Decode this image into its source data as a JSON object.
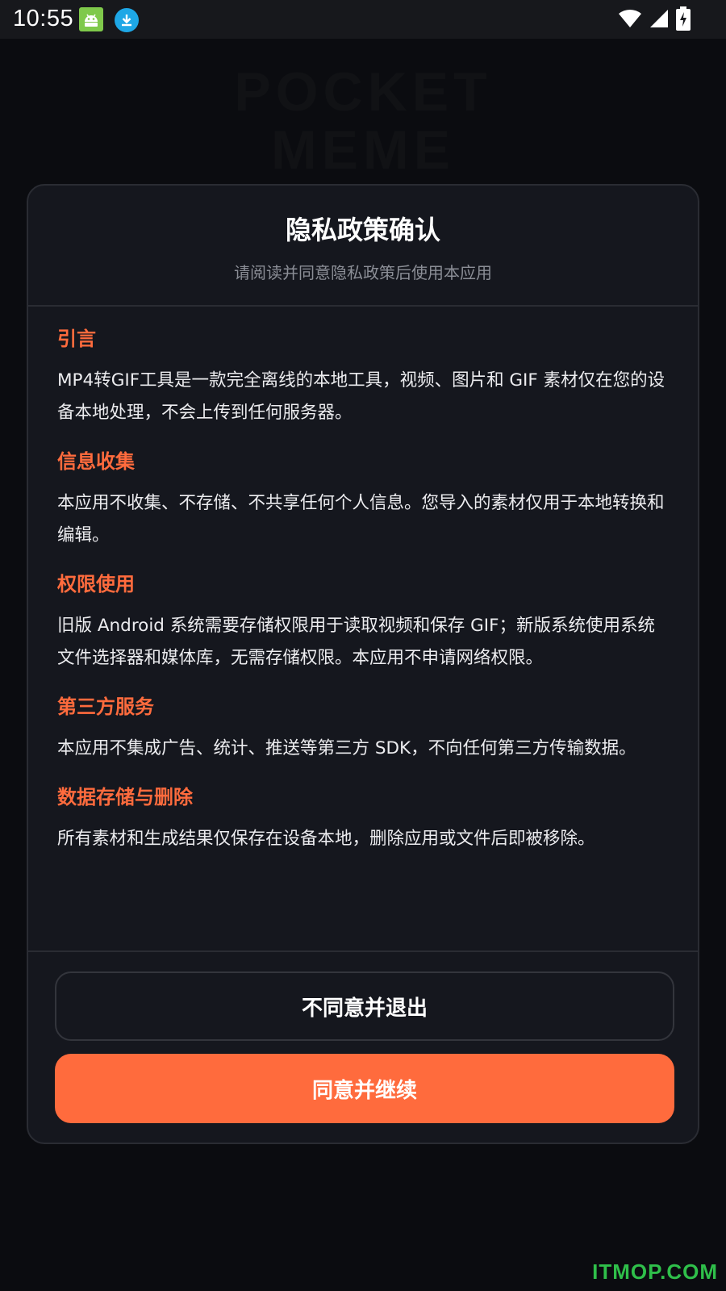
{
  "status_bar": {
    "time": "10:55",
    "icons": [
      "android-notification-icon",
      "download-icon",
      "wifi-icon",
      "cell-signal-icon",
      "battery-charging-icon"
    ]
  },
  "background": {
    "brand_line1": "POCKET",
    "brand_line2": "MEME"
  },
  "dialog": {
    "title": "隐私政策确认",
    "subtitle": "请阅读并同意隐私政策后使用本应用",
    "sections": [
      {
        "heading": "引言",
        "text": "MP4转GIF工具是一款完全离线的本地工具，视频、图片和 GIF 素材仅在您的设备本地处理，不会上传到任何服务器。"
      },
      {
        "heading": "信息收集",
        "text": "本应用不收集、不存储、不共享任何个人信息。您导入的素材仅用于本地转换和编辑。"
      },
      {
        "heading": "权限使用",
        "text": "旧版 Android 系统需要存储权限用于读取视频和保存 GIF；新版系统使用系统文件选择器和媒体库，无需存储权限。本应用不申请网络权限。"
      },
      {
        "heading": "第三方服务",
        "text": "本应用不集成广告、统计、推送等第三方 SDK，不向任何第三方传输数据。"
      },
      {
        "heading": "数据存储与删除",
        "text": "所有素材和生成结果仅保存在设备本地，删除应用或文件后即被移除。"
      }
    ],
    "decline_label": "不同意并退出",
    "accept_label": "同意并继续"
  },
  "watermark": "ITMOP.COM",
  "colors": {
    "accent": "#ff6b3d",
    "dialog_bg": "#15171e",
    "page_bg": "#0b0c10",
    "watermark": "#2fbf4a"
  }
}
